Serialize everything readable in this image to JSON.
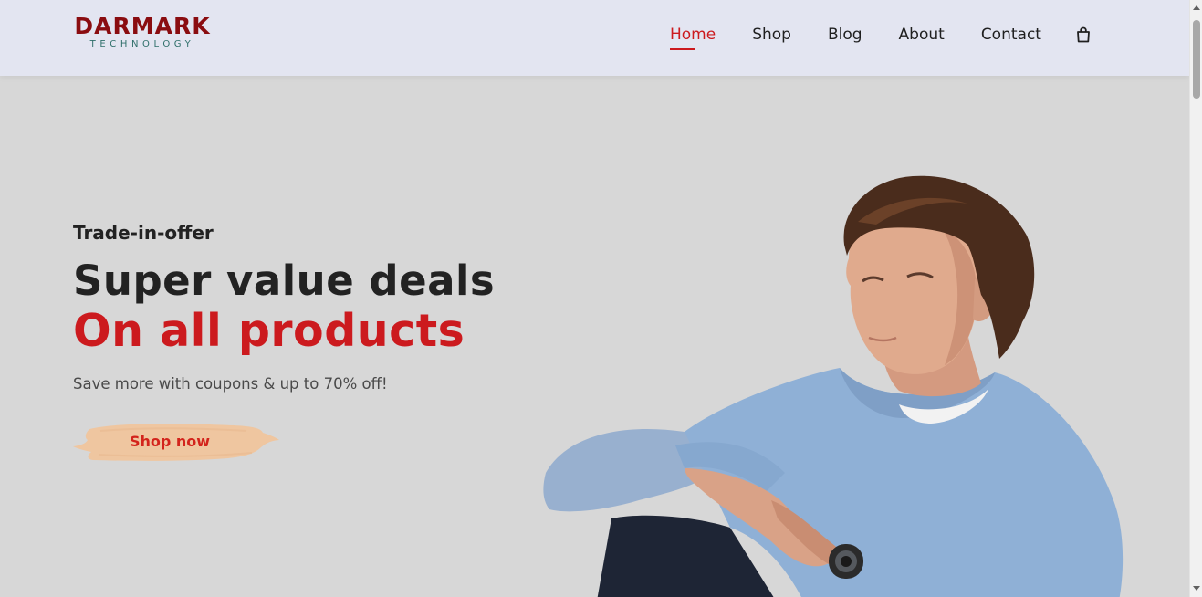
{
  "brand": {
    "name": "DARMARK",
    "tagline": "TECHNOLOGY",
    "color": "#8a0c10"
  },
  "nav": {
    "items": [
      {
        "label": "Home",
        "active": true
      },
      {
        "label": "Shop",
        "active": false
      },
      {
        "label": "Blog",
        "active": false
      },
      {
        "label": "About",
        "active": false
      },
      {
        "label": "Contact",
        "active": false
      }
    ],
    "cart_icon": "shopping-bag-icon"
  },
  "hero": {
    "kicker": "Trade-in-offer",
    "headline": "Super value deals",
    "headline_accent": "On all products",
    "subtext": "Save more with coupons & up to 70% off!",
    "cta_label": "Shop now",
    "accent_color": "#cc1a1e",
    "cta_brush_color": "#f0c9a1"
  }
}
